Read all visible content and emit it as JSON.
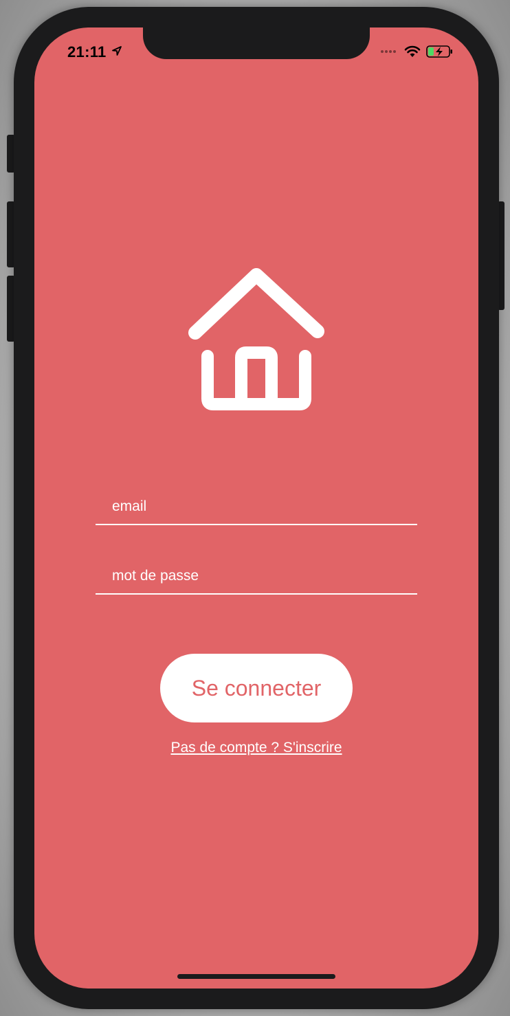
{
  "status_bar": {
    "time": "21:11",
    "icons": [
      "location-arrow-icon",
      "signal-dots-icon",
      "wifi-icon",
      "battery-charging-icon"
    ]
  },
  "app": {
    "logo_icon": "house-icon",
    "colors": {
      "background": "#e16467",
      "foreground": "#ffffff",
      "button_text": "#e16467"
    }
  },
  "form": {
    "email_placeholder": "email",
    "password_placeholder": "mot de passe",
    "submit_label": "Se connecter",
    "signup_link": "Pas de compte ? S'inscrire"
  }
}
